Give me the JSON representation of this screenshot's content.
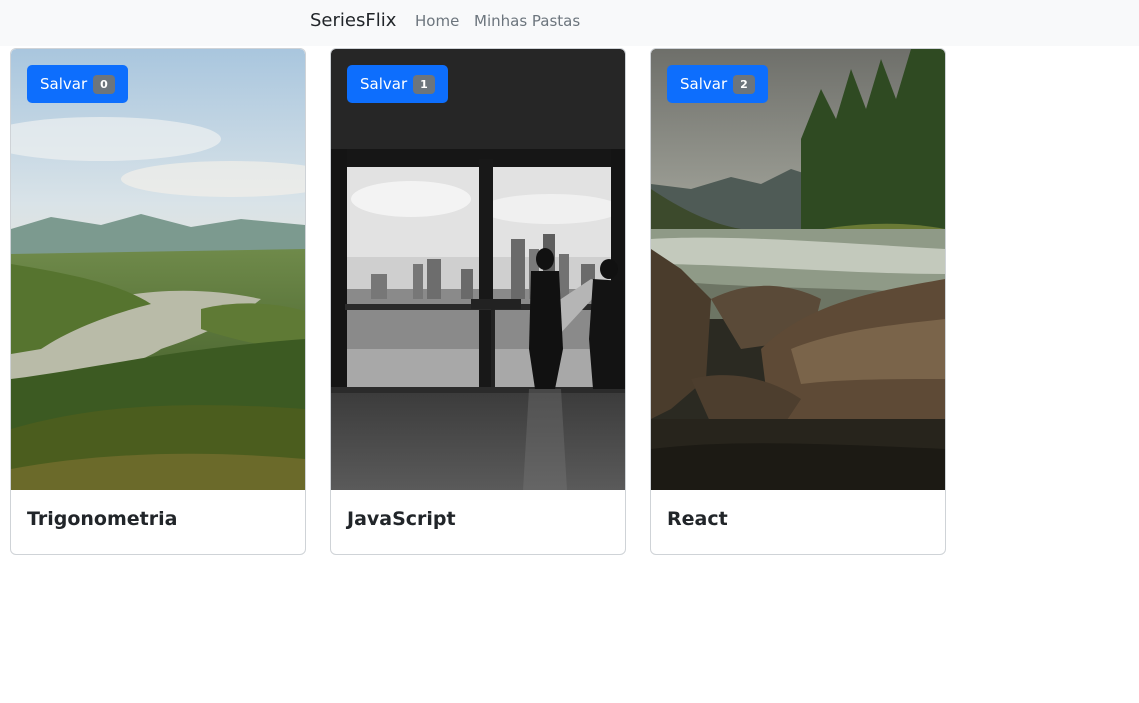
{
  "navbar": {
    "brand": "SeriesFlix",
    "links": [
      "Home",
      "Minhas Pastas"
    ]
  },
  "cards": [
    {
      "title": "Trigonometria",
      "save_label": "Salvar",
      "count": "0",
      "image": "tropical-lake-landscape"
    },
    {
      "title": "JavaScript",
      "save_label": "Salvar",
      "count": "1",
      "image": "city-skyline-window-silhouettes"
    },
    {
      "title": "React",
      "save_label": "Salvar",
      "count": "2",
      "image": "forest-river-rocks"
    }
  ],
  "colors": {
    "navbar_bg": "#f8f9fa",
    "button": "#0d6efd",
    "badge": "#6c757d"
  }
}
